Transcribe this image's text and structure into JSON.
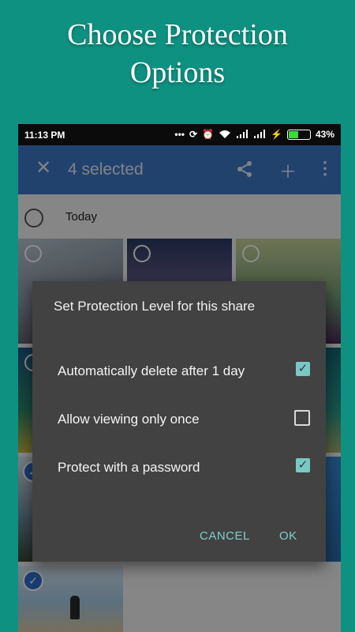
{
  "promo": {
    "title_line1": "Choose Protection",
    "title_line2": "Options"
  },
  "status_bar": {
    "time": "11:13 PM",
    "battery": "43%"
  },
  "toolbar": {
    "selected_label": "4 selected",
    "icons": [
      "close-icon",
      "share-icon",
      "add-icon",
      "more-vert-icon"
    ]
  },
  "gallery": {
    "section_label": "Today"
  },
  "dialog": {
    "title": "Set Protection Level for this share",
    "options": [
      {
        "label": "Automatically delete after 1 day",
        "checked": true
      },
      {
        "label": "Allow viewing only once",
        "checked": false
      },
      {
        "label": "Protect with a password",
        "checked": true
      }
    ],
    "cancel_label": "CANCEL",
    "ok_label": "OK"
  },
  "colors": {
    "background": "#0f9182",
    "toolbar": "#3f78c9",
    "dialog": "#424242",
    "accent": "#78c9c4"
  }
}
